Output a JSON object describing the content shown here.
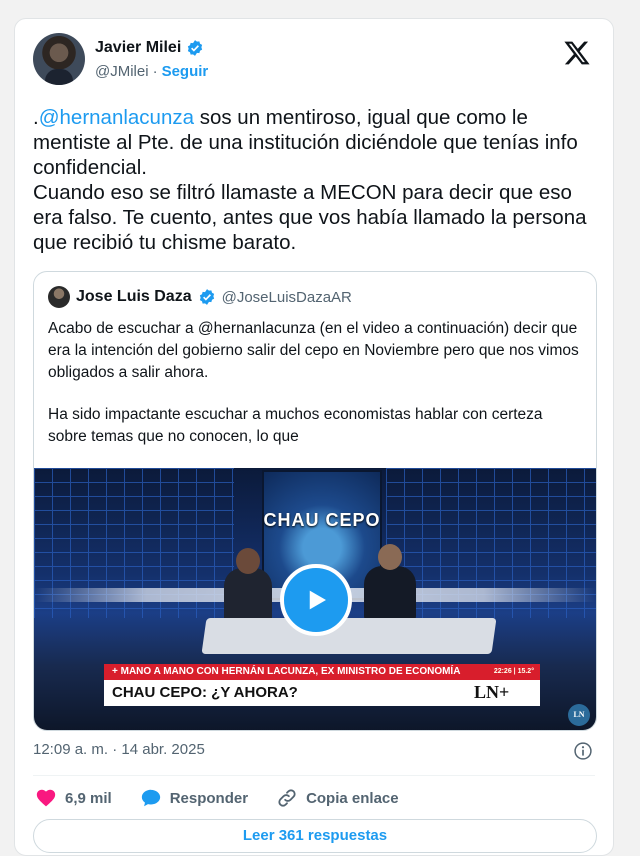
{
  "author": {
    "display_name": "Javier Milei",
    "handle": "@JMilei",
    "separator": "·",
    "follow_label": "Seguir"
  },
  "tweet": {
    "mention": "@hernanlacunza",
    "lead": ".",
    "line1_rest": " sos un mentiroso, igual que como le mentiste al Pte. de una institución diciéndole que tenías info confidencial.",
    "line2": "Cuando eso se filtró llamaste a MECON para decir que eso era falso. Te cuento, antes que vos había llamado la persona que recibió tu chisme barato."
  },
  "quoted": {
    "display_name": "Jose Luis Daza",
    "handle": "@JoseLuisDazaAR",
    "para1": "Acabo de escuchar a @hernanlacunza (en el video a continuación) decir que era la intención del gobierno salir del cepo en Noviembre pero que nos vimos obligados a salir ahora.",
    "para2": "Ha sido impactante escuchar a muchos economistas hablar con certeza sobre temas que no conocen, lo que",
    "video": {
      "screen_title": "CHAU CEPO",
      "ticker_top": "+ MANO A MANO CON HERNÁN LACUNZA, EX MINISTRO DE ECONOMÍA",
      "ticker_time": "22:26 | 15.2°",
      "ticker_bottom": "CHAU CEPO: ¿Y AHORA?",
      "channel_logo": "LN+",
      "corner_logo": "LN"
    }
  },
  "meta": {
    "timestamp": "12:09 a. m. · 14 abr. 2025"
  },
  "actions": {
    "likes": "6,9 mil",
    "reply_label": "Responder",
    "copy_link_label": "Copia enlace",
    "read_replies_label": "Leer 361 respuestas"
  },
  "colors": {
    "accent": "#1d9bf0",
    "like": "#f91880",
    "text": "#0f1419",
    "muted": "#536471"
  },
  "icons": [
    "verified-badge-icon",
    "x-logo-icon",
    "play-icon",
    "info-icon",
    "heart-icon",
    "reply-bubble-icon",
    "link-icon"
  ]
}
